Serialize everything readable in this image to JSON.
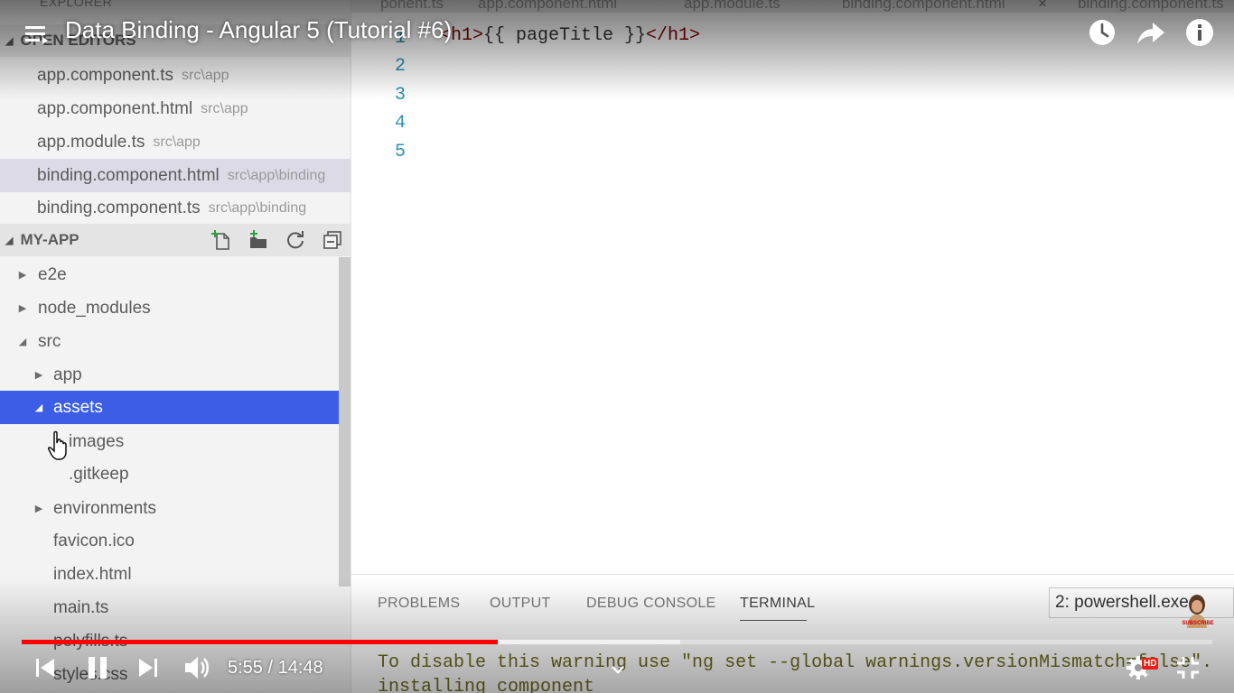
{
  "video": {
    "title": "Data Binding - Angular 5 (Tutorial #6)",
    "time_current": "5:55",
    "time_total": "14:48",
    "time_separator": " / ",
    "progress_fraction": 0.3999,
    "buffered_fraction": 0.553,
    "quality_badge": "HD",
    "subscribe_label": "SUBSCRIBE",
    "colors": {
      "progress": "#ff0000",
      "hd_badge": "#e62117"
    }
  },
  "vscode": {
    "explorer_label": "EXPLORER",
    "open_editors": {
      "header": "OPEN EDITORS",
      "items": [
        {
          "name": "app.component.ts",
          "path": "src\\app"
        },
        {
          "name": "app.component.html",
          "path": "src\\app"
        },
        {
          "name": "app.module.ts",
          "path": "src\\app"
        },
        {
          "name": "binding.component.html",
          "path": "src\\app\\binding",
          "active": true
        },
        {
          "name": "binding.component.ts",
          "path": "src\\app\\binding"
        }
      ]
    },
    "project": {
      "header": "MY-APP",
      "tree": [
        {
          "label": "e2e",
          "arrow": "▶"
        },
        {
          "label": "node_modules",
          "arrow": "▶"
        },
        {
          "label": "src",
          "arrow": "◢"
        },
        {
          "label": "app",
          "arrow": "▶"
        },
        {
          "label": "assets",
          "arrow": "◢",
          "selected": true
        },
        {
          "label": "images",
          "arrow": ""
        },
        {
          "label": ".gitkeep",
          "arrow": ""
        },
        {
          "label": "environments",
          "arrow": "▶"
        },
        {
          "label": "favicon.ico",
          "arrow": ""
        },
        {
          "label": "index.html",
          "arrow": ""
        },
        {
          "label": "main.ts",
          "arrow": ""
        },
        {
          "label": "polyfills.ts",
          "arrow": ""
        },
        {
          "label": "styles.css",
          "arrow": ""
        }
      ]
    },
    "tabs": [
      "ponent.ts",
      "app.component.html",
      "app.module.ts",
      "binding.component.html",
      "binding.component.ts"
    ],
    "tab_close_glyph": "×",
    "editor": {
      "line_numbers": [
        "1",
        "2",
        "3",
        "4",
        "5"
      ],
      "code": {
        "open_tag": "<h1>",
        "content": "{{ pageTitle }}",
        "close_tag": "</h1>"
      }
    },
    "panel": {
      "tabs": [
        "PROBLEMS",
        "OUTPUT",
        "DEBUG CONSOLE",
        "TERMINAL"
      ],
      "active_tab": "TERMINAL",
      "terminal_select": "2: powershell.exe",
      "terminal_lines": [
        "To disable this warning use \"ng set --global warnings.versionMismatch=false\".",
        "installing component"
      ]
    }
  }
}
